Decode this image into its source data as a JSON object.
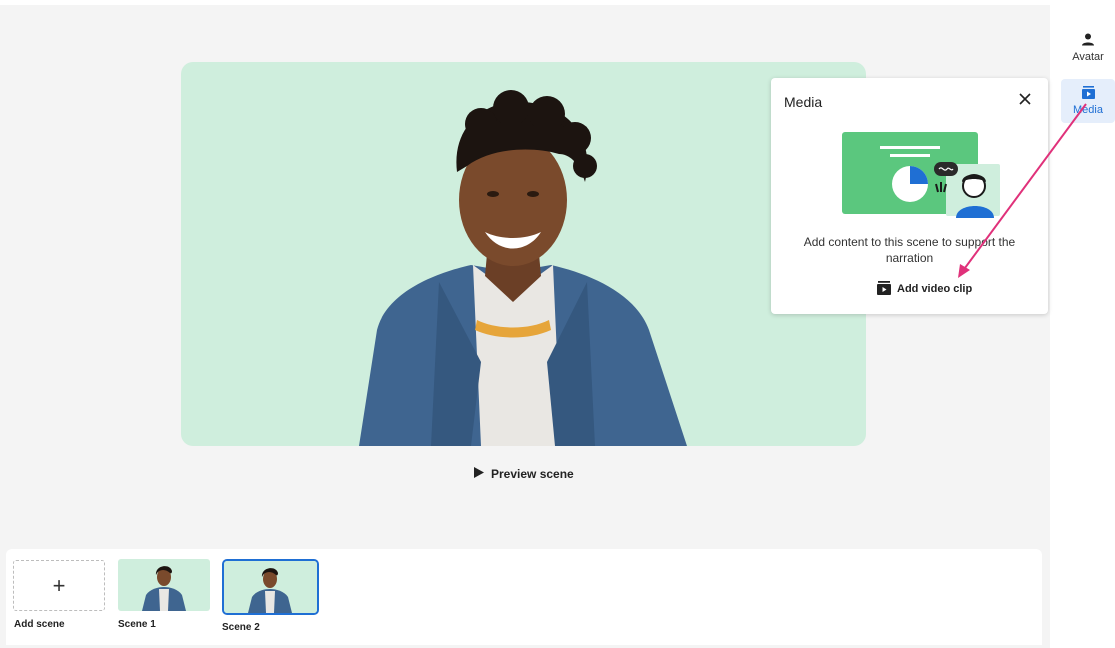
{
  "rail": {
    "avatar_label": "Avatar",
    "media_label": "Media"
  },
  "canvas": {
    "preview_label": "Preview scene"
  },
  "media_panel": {
    "title": "Media",
    "description": "Add content to this scene to support the narration",
    "add_clip_label": "Add video clip"
  },
  "timeline": {
    "add_scene_symbol": "+",
    "add_scene_label": "Add scene",
    "scenes": [
      {
        "label": "Scene 1"
      },
      {
        "label": "Scene 2"
      }
    ]
  },
  "colors": {
    "accent": "#1f6fd4",
    "canvas_bg": "#cfeedd",
    "annotation_arrow": "#e0317a"
  },
  "icons": [
    "person-icon",
    "media-icon",
    "close-icon",
    "play-icon",
    "video-clip-icon",
    "plus-icon"
  ]
}
